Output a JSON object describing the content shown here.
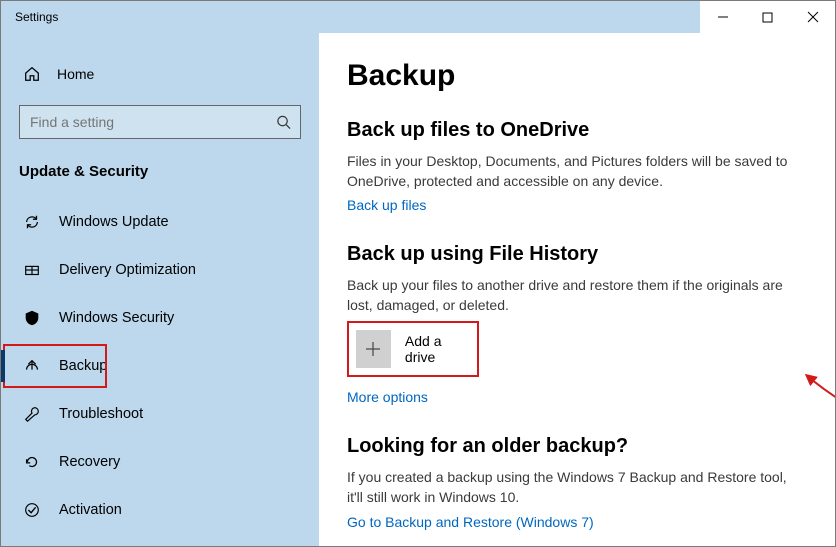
{
  "window": {
    "title": "Settings"
  },
  "sidebar": {
    "home": "Home",
    "search_placeholder": "Find a setting",
    "category": "Update & Security",
    "items": [
      {
        "label": "Windows Update"
      },
      {
        "label": "Delivery Optimization"
      },
      {
        "label": "Windows Security"
      },
      {
        "label": "Backup"
      },
      {
        "label": "Troubleshoot"
      },
      {
        "label": "Recovery"
      },
      {
        "label": "Activation"
      }
    ]
  },
  "main": {
    "title": "Backup",
    "section1": {
      "title": "Back up files to OneDrive",
      "desc": "Files in your Desktop, Documents, and Pictures folders will be saved to OneDrive, protected and accessible on any device.",
      "link": "Back up files"
    },
    "section2": {
      "title": "Back up using File History",
      "desc": "Back up your files to another drive and restore them if the originals are lost, damaged, or deleted.",
      "button": "Add a drive",
      "link": "More options"
    },
    "section3": {
      "title": "Looking for an older backup?",
      "desc": "If you created a backup using the Windows 7 Backup and Restore tool, it'll still work in Windows 10.",
      "link": "Go to Backup and Restore (Windows 7)"
    }
  }
}
